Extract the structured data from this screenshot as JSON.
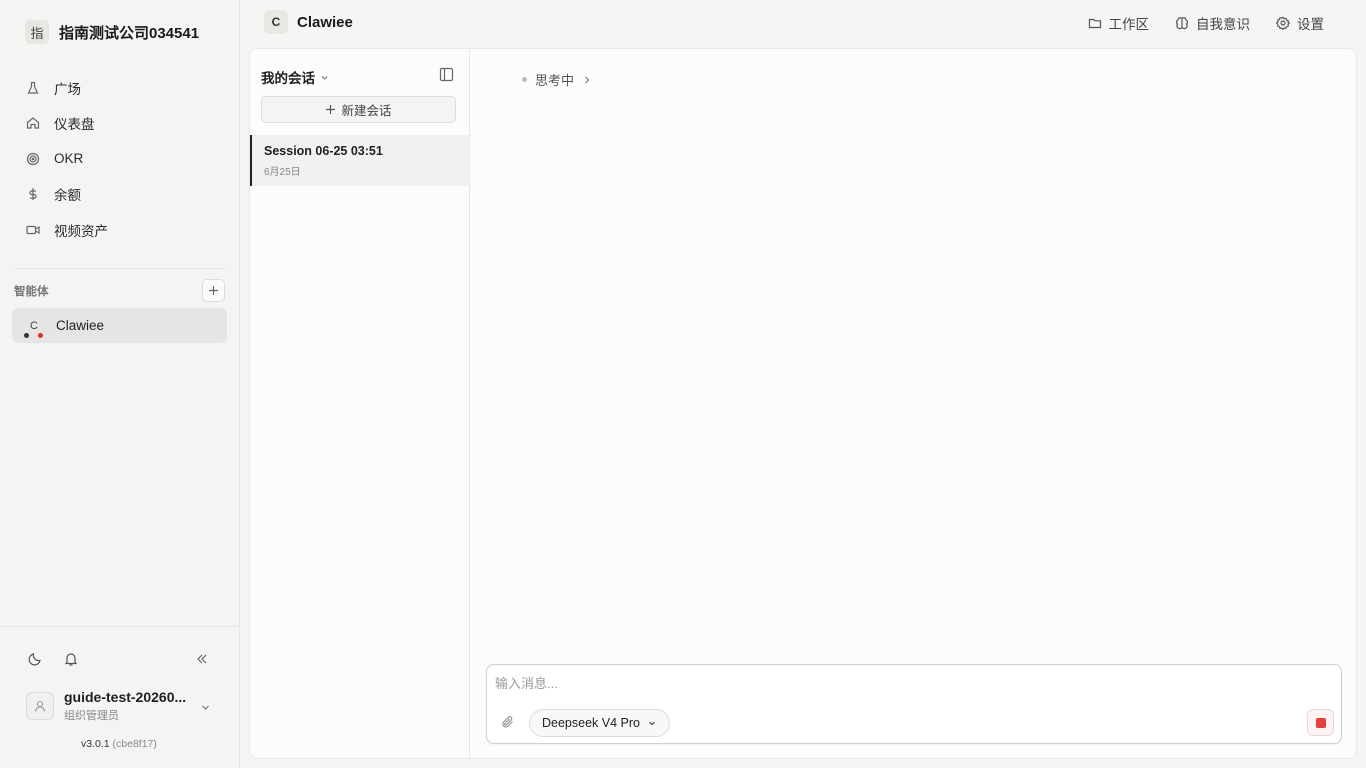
{
  "org": {
    "logo_char": "指",
    "name": "指南测试公司034541"
  },
  "nav": [
    {
      "label": "广场",
      "icon": "flask-icon"
    },
    {
      "label": "仪表盘",
      "icon": "home-icon"
    },
    {
      "label": "OKR",
      "icon": "target-icon"
    },
    {
      "label": "余额",
      "icon": "dollar-icon"
    },
    {
      "label": "视频资产",
      "icon": "video-icon"
    }
  ],
  "agents": {
    "label": "智能体",
    "items": [
      {
        "avatar": "C",
        "name": "Clawiee"
      }
    ]
  },
  "user": {
    "name": "guide-test-20260...",
    "role": "组织管理员"
  },
  "version": {
    "number": "v3.0.1",
    "hash": "(cbe8f17)"
  },
  "header": {
    "agent_avatar": "C",
    "agent_name": "Clawiee",
    "actions": [
      {
        "label": "工作区",
        "icon": "folder-icon"
      },
      {
        "label": "自我意识",
        "icon": "brain-icon"
      },
      {
        "label": "设置",
        "icon": "gear-icon"
      }
    ]
  },
  "sessions": {
    "title": "我的会话",
    "new_label": "新建会话",
    "items": [
      {
        "name": "Session 06-25 03:51",
        "date": "6月25日"
      }
    ]
  },
  "chat": {
    "thinking": "思考中",
    "input_placeholder": "输入消息...",
    "model": "Deepseek V4 Pro"
  },
  "colors": {
    "accent_red": "#e5403a",
    "status_dot": "#e0302b"
  }
}
